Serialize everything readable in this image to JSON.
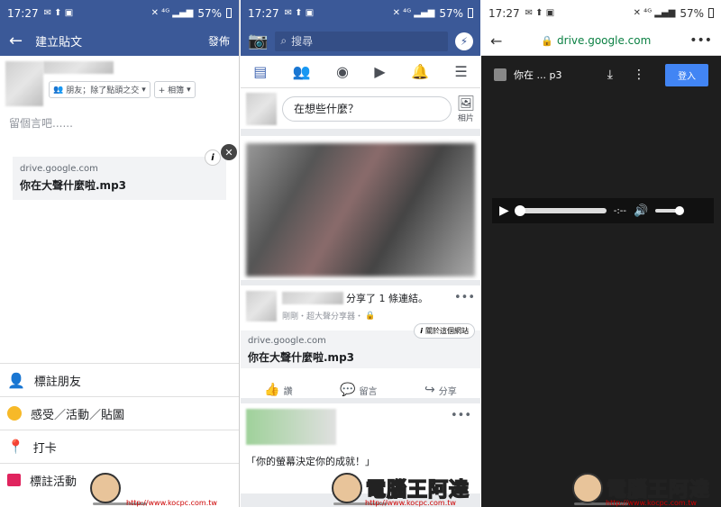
{
  "status": {
    "time": "17:27",
    "battery": "57%",
    "signal": "4G"
  },
  "panel1": {
    "title": "建立貼文",
    "post_label": "發佈",
    "audience": "朋友；除了點頭之交",
    "album": "+ 相簿",
    "placeholder": "留個言吧......",
    "link": {
      "domain": "drive.google.com",
      "title": "你在大聲什麼啦.mp3"
    },
    "menu": [
      {
        "label": "標註朋友",
        "icon": "tag-friend-icon"
      },
      {
        "label": "感受／活動／貼圖",
        "icon": "smiley-icon"
      },
      {
        "label": "打卡",
        "icon": "location-pin-icon"
      },
      {
        "label": "標註活動",
        "icon": "calendar-icon"
      }
    ]
  },
  "panel2": {
    "search_placeholder": "搜尋",
    "composer": "在想些什麼？",
    "photo_label": "相片",
    "post": {
      "action": "分享了 1 條連結。",
      "meta": "剛剛・超大聲分享器・",
      "about_site": "關於這個網站",
      "link": {
        "domain": "drive.google.com",
        "title": "你在大聲什麼啦.mp3"
      }
    },
    "actions": {
      "like": "讚",
      "comment": "留言",
      "share": "分享"
    },
    "snippet": "「你的螢幕決定你的成就！」"
  },
  "panel3": {
    "url": "drive.google.com",
    "file": "你在 ... p3",
    "login": "登入",
    "time": "-:--"
  },
  "watermark": {
    "text": "電腦王阿達",
    "url": "http://www.kocpc.com.tw"
  }
}
